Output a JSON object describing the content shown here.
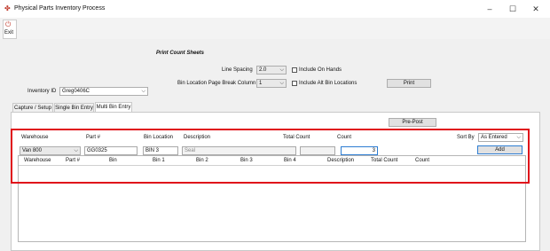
{
  "window": {
    "title": "Physical Parts Inventory Process",
    "minimize": "–",
    "maximize": "☐",
    "close": "✕"
  },
  "toolbar": {
    "exit_label": "Exit"
  },
  "print_count": {
    "heading": "Print Count Sheets",
    "line_spacing_label": "Line Spacing",
    "line_spacing_value": "2.0",
    "include_on_hands": "Include On Hands",
    "page_break_label": "Bin Location Page Break Column",
    "page_break_value": "1",
    "include_alt_bin": "Include Alt Bin Locations",
    "print_button": "Print"
  },
  "inventory_id": {
    "label": "Inventory ID",
    "value": "Greg0406C"
  },
  "tabs": [
    {
      "label": "Capture / Setup"
    },
    {
      "label": "Single Bin Entry"
    },
    {
      "label": "Multi Bin Entry"
    }
  ],
  "multi_bin": {
    "pre_post_button": "Pre-Post",
    "labels": {
      "warehouse": "Warehouse",
      "part": "Part #",
      "bin_location": "Bin Location",
      "description": "Description",
      "total_count": "Total Count",
      "count": "Count",
      "sort_by": "Sort By"
    },
    "values": {
      "warehouse": "Van 800",
      "part": "GG0325",
      "bin_location": "BIN 3",
      "description": "Seal",
      "total_count": "",
      "count": "3",
      "sort_by": "As Entered"
    },
    "add_button": "Add",
    "grid_columns": [
      "Warehouse",
      "Part #",
      "Bin",
      "Bin 1",
      "Bin 2",
      "Bin 3",
      "Bin 4",
      "Description",
      "Total Count",
      "Count"
    ]
  },
  "colors": {
    "highlight_border": "#e0101a",
    "window_bg": "#f0f0f0"
  },
  "icons": {
    "app": "app-logo-icon",
    "exit": "exit-icon",
    "dropdown": "chevron-down-icon"
  }
}
